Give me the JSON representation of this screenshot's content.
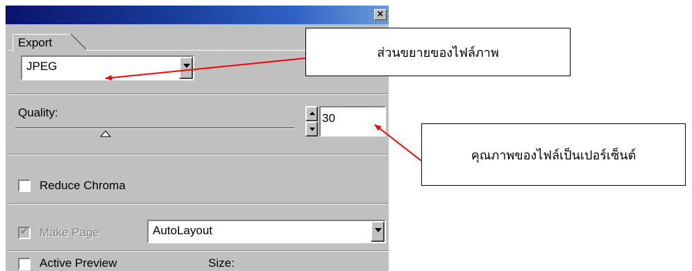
{
  "window": {
    "close_icon": "×"
  },
  "tabs": [
    {
      "label": "Export",
      "selected": true
    }
  ],
  "format_select": {
    "value": "JPEG"
  },
  "quality": {
    "label": "Quality:",
    "value": "30"
  },
  "reduce_chroma": {
    "label": "Reduce Chroma",
    "checked": false
  },
  "make_page": {
    "label": "Make Page",
    "checked": true,
    "enabled": false,
    "layout_value": "AutoLayout"
  },
  "active_preview": {
    "label": "Active Preview",
    "checked": false,
    "size_label": "Size:"
  },
  "annotations": [
    {
      "text": "ส่วนขยายของไฟล์ภาพ",
      "color": "#ff0000"
    },
    {
      "text": "คุณภาพของไฟล์เป็นเปอร์เซ็นต์",
      "color": "#ff0000"
    }
  ],
  "colors": {
    "panel_bg": "#c0c0c0",
    "title_gradient_start": "#09136d",
    "title_gradient_end": "#6a9ad8",
    "arrow": "#ff0000"
  }
}
